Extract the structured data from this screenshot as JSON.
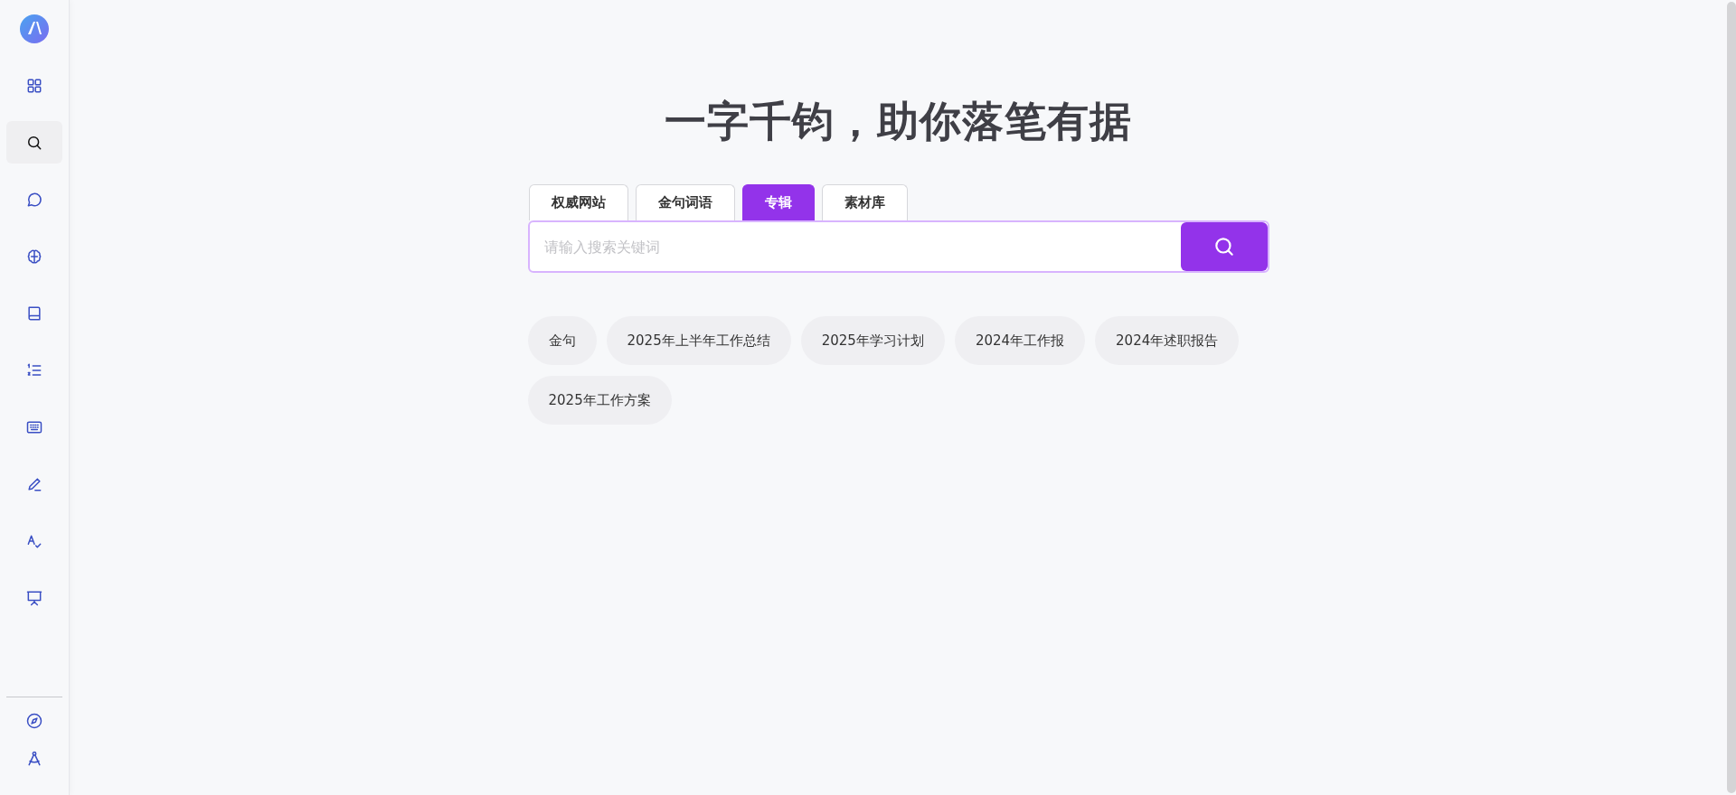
{
  "sidebar": {
    "items": [
      {
        "kind": "grid",
        "selected": false
      },
      {
        "kind": "search",
        "selected": true
      },
      {
        "kind": "chat",
        "selected": false
      },
      {
        "kind": "brain",
        "selected": false
      },
      {
        "kind": "book",
        "selected": false
      },
      {
        "kind": "list",
        "selected": false
      },
      {
        "kind": "keyboard",
        "selected": false
      },
      {
        "kind": "pen",
        "selected": false
      },
      {
        "kind": "spellcheck",
        "selected": false
      },
      {
        "kind": "presentation",
        "selected": false
      }
    ],
    "bottom_items": [
      {
        "kind": "compass",
        "selected": false
      },
      {
        "kind": "drafting",
        "selected": false
      }
    ]
  },
  "heading": "一字千钧，助你落笔有据",
  "tabs": [
    {
      "label": "权威网站",
      "selected": false
    },
    {
      "label": "金句词语",
      "selected": false
    },
    {
      "label": "专辑",
      "selected": true
    },
    {
      "label": "素材库",
      "selected": false
    }
  ],
  "search": {
    "placeholder": "请输入搜索关键词"
  },
  "suggestions": [
    "金句",
    "2025年上半年工作总结",
    "2025年学习计划",
    "2024年工作报",
    "2024年述职报告",
    "2025年工作方案"
  ]
}
